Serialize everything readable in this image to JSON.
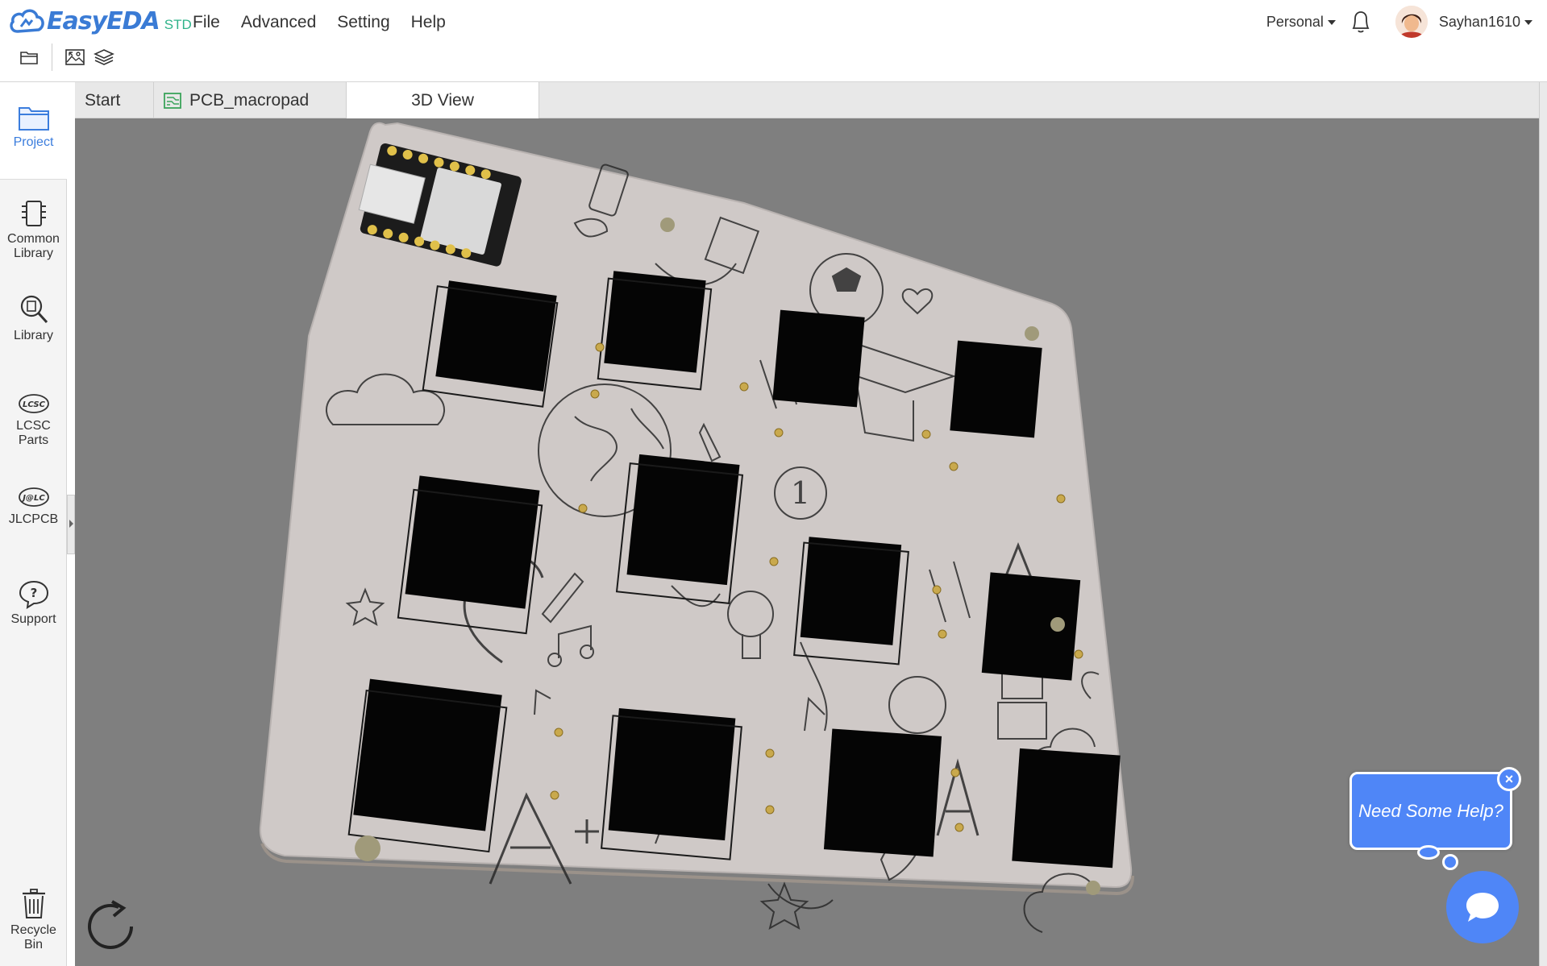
{
  "app": {
    "logo_text": "EasyEDA",
    "logo_suffix": "STD"
  },
  "menu": [
    "File",
    "Advanced",
    "Setting",
    "Help"
  ],
  "toolbar": {
    "icons": [
      "folder-icon",
      "import-image-icon",
      "layers-icon"
    ]
  },
  "header_right": {
    "workspace": "Personal",
    "username": "Sayhan1610"
  },
  "sidebar": {
    "items": [
      {
        "label": "Project",
        "icon": "project-folder-icon",
        "active": true
      },
      {
        "label": "Common Library",
        "icon": "chip-icon"
      },
      {
        "label": "Library",
        "icon": "library-search-icon"
      },
      {
        "label": "LCSC Parts",
        "icon": "lcsc-logo-icon"
      },
      {
        "label": "JLCPCB",
        "icon": "jlc-logo-icon"
      },
      {
        "label": "Support",
        "icon": "help-bubble-icon"
      },
      {
        "label": "Recycle Bin",
        "icon": "trash-icon"
      }
    ]
  },
  "tabs": [
    {
      "label": "Start"
    },
    {
      "label": "PCB_macropad",
      "icon": "pcb-icon"
    },
    {
      "label": "3D View",
      "active": true
    }
  ],
  "viewport": {
    "background": "#7f7f7f",
    "board_color": "#cfc9c7",
    "mcu_silk_label": "1",
    "switch_count": 12
  },
  "help": {
    "bubble_text": "Need Some Help?",
    "accent": "#4f86f7"
  }
}
